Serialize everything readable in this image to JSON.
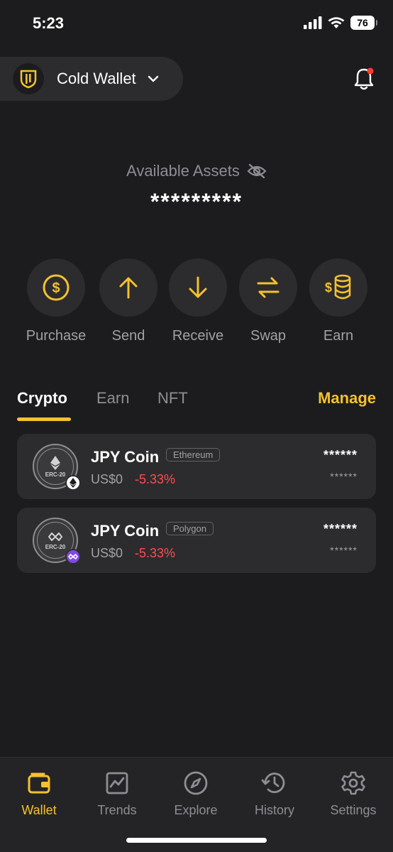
{
  "status_bar": {
    "time": "5:23",
    "battery": "76"
  },
  "header": {
    "wallet_name": "Cold Wallet"
  },
  "assets": {
    "label": "Available Assets",
    "value": "*********"
  },
  "actions": [
    {
      "label": "Purchase",
      "icon": "dollar-icon"
    },
    {
      "label": "Send",
      "icon": "arrow-up-icon"
    },
    {
      "label": "Receive",
      "icon": "arrow-down-icon"
    },
    {
      "label": "Swap",
      "icon": "swap-icon"
    },
    {
      "label": "Earn",
      "icon": "coins-icon"
    }
  ],
  "tabs": {
    "items": [
      {
        "label": "Crypto"
      },
      {
        "label": "Earn"
      },
      {
        "label": "NFT"
      }
    ],
    "active": "Crypto",
    "manage_label": "Manage"
  },
  "asset_list": [
    {
      "name": "JPY Coin",
      "chain": "Ethereum",
      "price": "US$0",
      "change": "-5.33%",
      "balance": "******",
      "fiat": "******",
      "token_standard": "ERC-20"
    },
    {
      "name": "JPY Coin",
      "chain": "Polygon",
      "price": "US$0",
      "change": "-5.33%",
      "balance": "******",
      "fiat": "******",
      "token_standard": "ERC-20"
    }
  ],
  "bottom_nav": [
    {
      "label": "Wallet",
      "icon": "wallet-icon"
    },
    {
      "label": "Trends",
      "icon": "chart-icon"
    },
    {
      "label": "Explore",
      "icon": "compass-icon"
    },
    {
      "label": "History",
      "icon": "history-icon"
    },
    {
      "label": "Settings",
      "icon": "gear-icon"
    }
  ],
  "colors": {
    "accent": "#f5c12e",
    "negative": "#ff4d4f",
    "background": "#1c1c1e",
    "card": "#2c2c2e"
  }
}
